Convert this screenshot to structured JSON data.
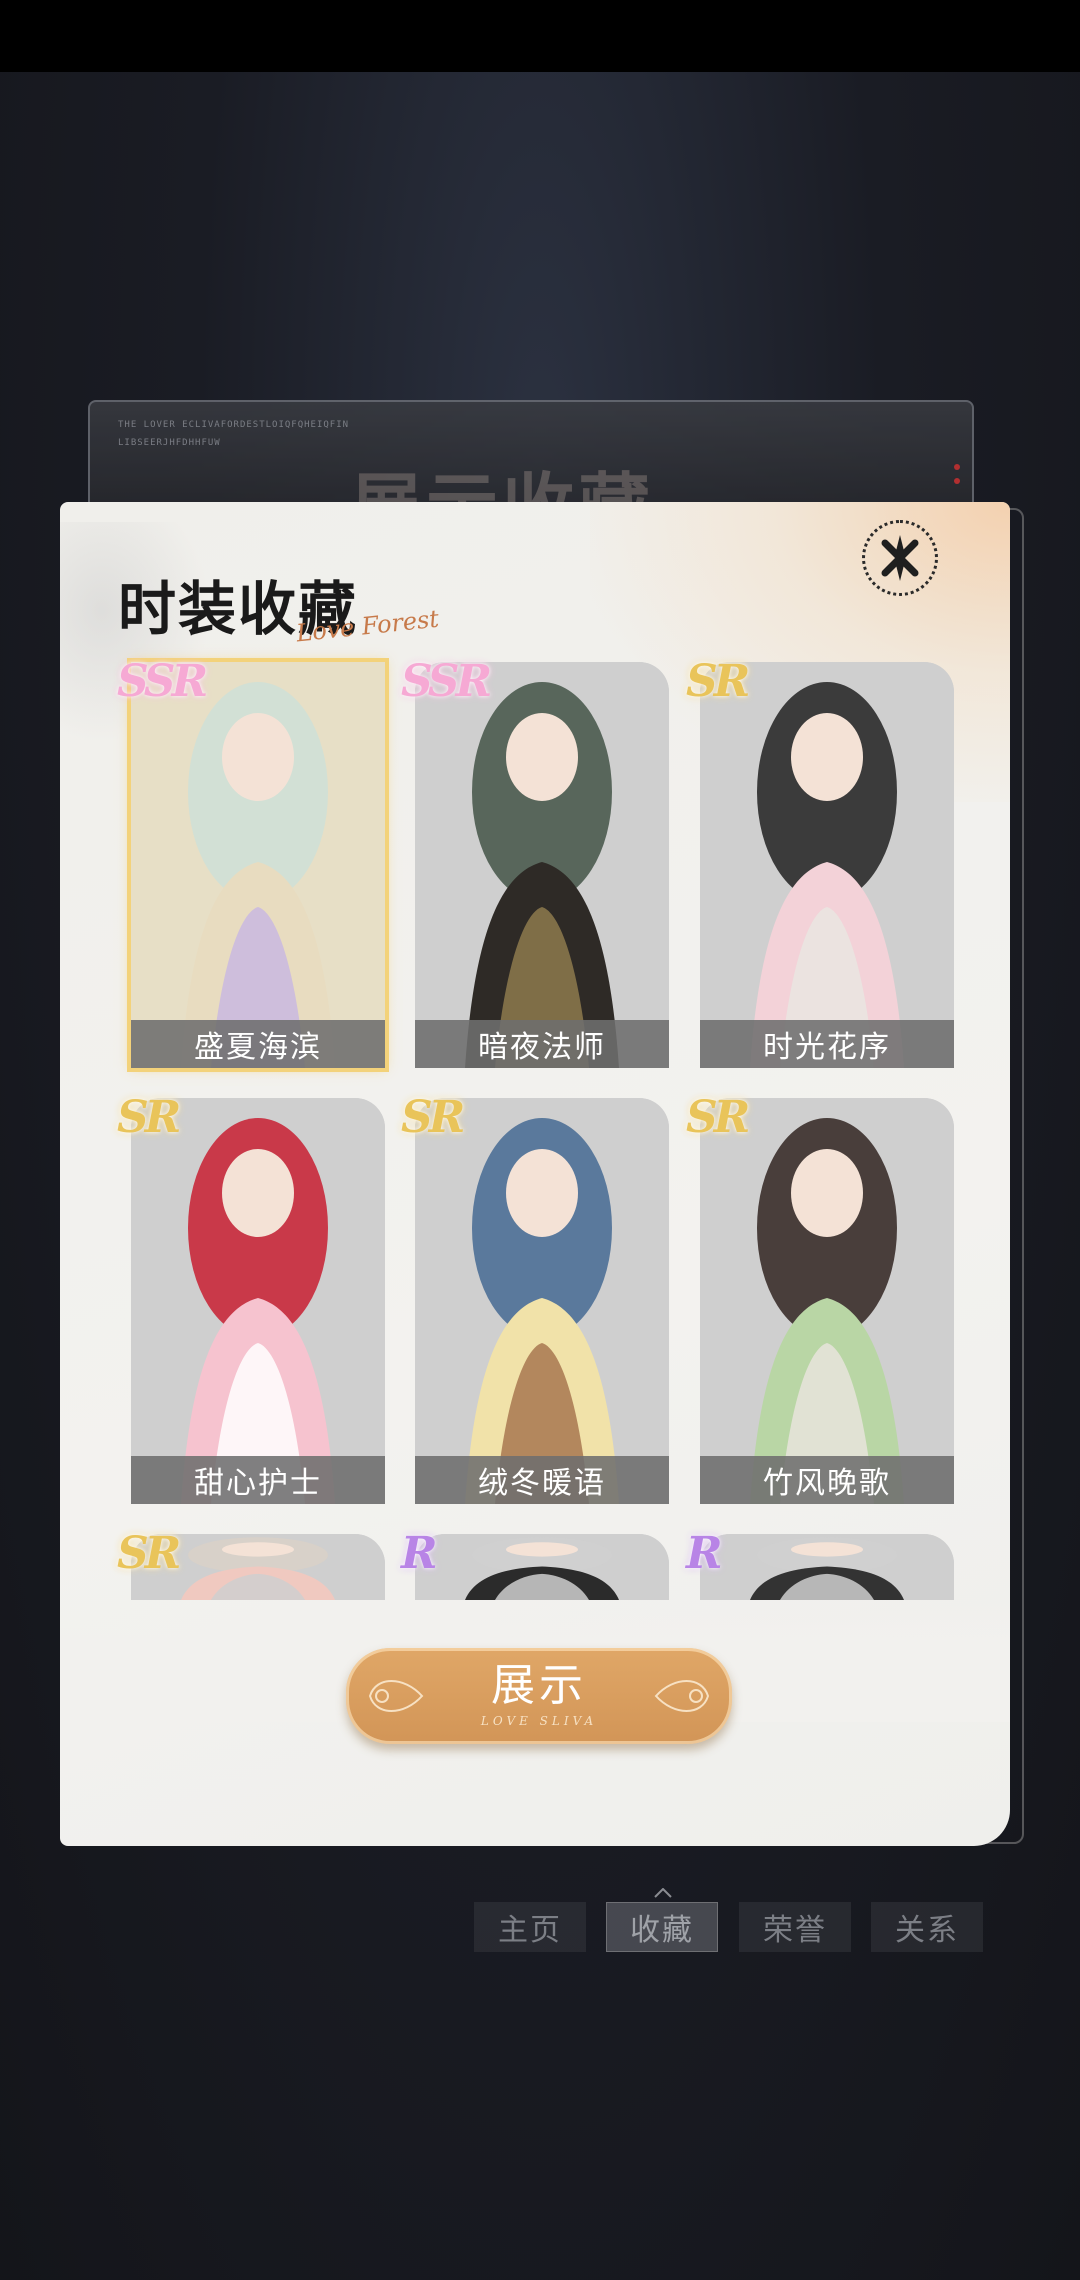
{
  "background_card": {
    "title": "展示收藏",
    "tiny_line_1": "THE LOVER ECLIVAFORDESTLOIQFQHEIQFIN",
    "tiny_line_2": "LIBSEERJHFDHHFUW"
  },
  "modal": {
    "title": "时装收藏",
    "script_text": "Love Forest",
    "close_icon": "close-x-icon"
  },
  "items": [
    {
      "name": "盛夏海滨",
      "rarity": "SSR",
      "selected": true
    },
    {
      "name": "暗夜法师",
      "rarity": "SSR",
      "selected": false
    },
    {
      "name": "时光花序",
      "rarity": "SR",
      "selected": false
    },
    {
      "name": "甜心护士",
      "rarity": "SR",
      "selected": false
    },
    {
      "name": "绒冬暖语",
      "rarity": "SR",
      "selected": false
    },
    {
      "name": "竹风晚歌",
      "rarity": "SR",
      "selected": false
    },
    {
      "name": "",
      "rarity": "SR",
      "selected": false
    },
    {
      "name": "",
      "rarity": "R",
      "selected": false
    },
    {
      "name": "",
      "rarity": "R",
      "selected": false
    }
  ],
  "show_button": {
    "label": "展示",
    "sub": "LOVE SLIVA"
  },
  "tabs": [
    {
      "label": "主页",
      "active": false
    },
    {
      "label": "收藏",
      "active": true
    },
    {
      "label": "荣誉",
      "active": false
    },
    {
      "label": "关系",
      "active": false
    }
  ],
  "colors": {
    "ssr": "#f6a9d4",
    "sr": "#e9c45a",
    "r": "#b884e6",
    "button": "#d89d5e"
  }
}
